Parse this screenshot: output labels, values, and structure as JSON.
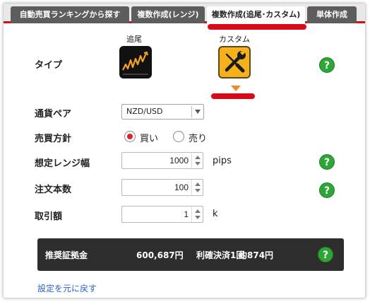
{
  "tabs": [
    {
      "label": "自動売買ランキングから探す"
    },
    {
      "label": "複数作成(レンジ)"
    },
    {
      "label": "複数作成(追尾･カスタム)"
    },
    {
      "label": "単体作成"
    }
  ],
  "type_row": {
    "label": "タイプ",
    "options": [
      {
        "label": "追尾",
        "icon": "trail-chart-icon"
      },
      {
        "label": "カスタム",
        "icon": "wrench-screwdriver-icon"
      }
    ]
  },
  "currency_pair": {
    "label": "通貨ペア",
    "selected": "NZD/USD"
  },
  "trade_direction": {
    "label": "売買方針",
    "options": [
      {
        "label": "買い",
        "checked": true
      },
      {
        "label": "売り",
        "checked": false
      }
    ]
  },
  "range_width": {
    "label": "想定レンジ幅",
    "value": "1000",
    "unit": "pips"
  },
  "order_count": {
    "label": "注文本数",
    "value": "100"
  },
  "trade_amount": {
    "label": "取引額",
    "value": "1",
    "unit": "k"
  },
  "summary": {
    "label": "推奨証拠金",
    "amount": "600,687円",
    "profit_count": "利確決済1回",
    "profit_yen": "約874円"
  },
  "reset_link": "設定を元に戻す",
  "help_glyph": "?",
  "colors": {
    "accent_red": "#d70c18",
    "help_green": "#2ea636",
    "custom_icon_bg": "#f5b01a",
    "link_blue": "#2a62c9"
  }
}
